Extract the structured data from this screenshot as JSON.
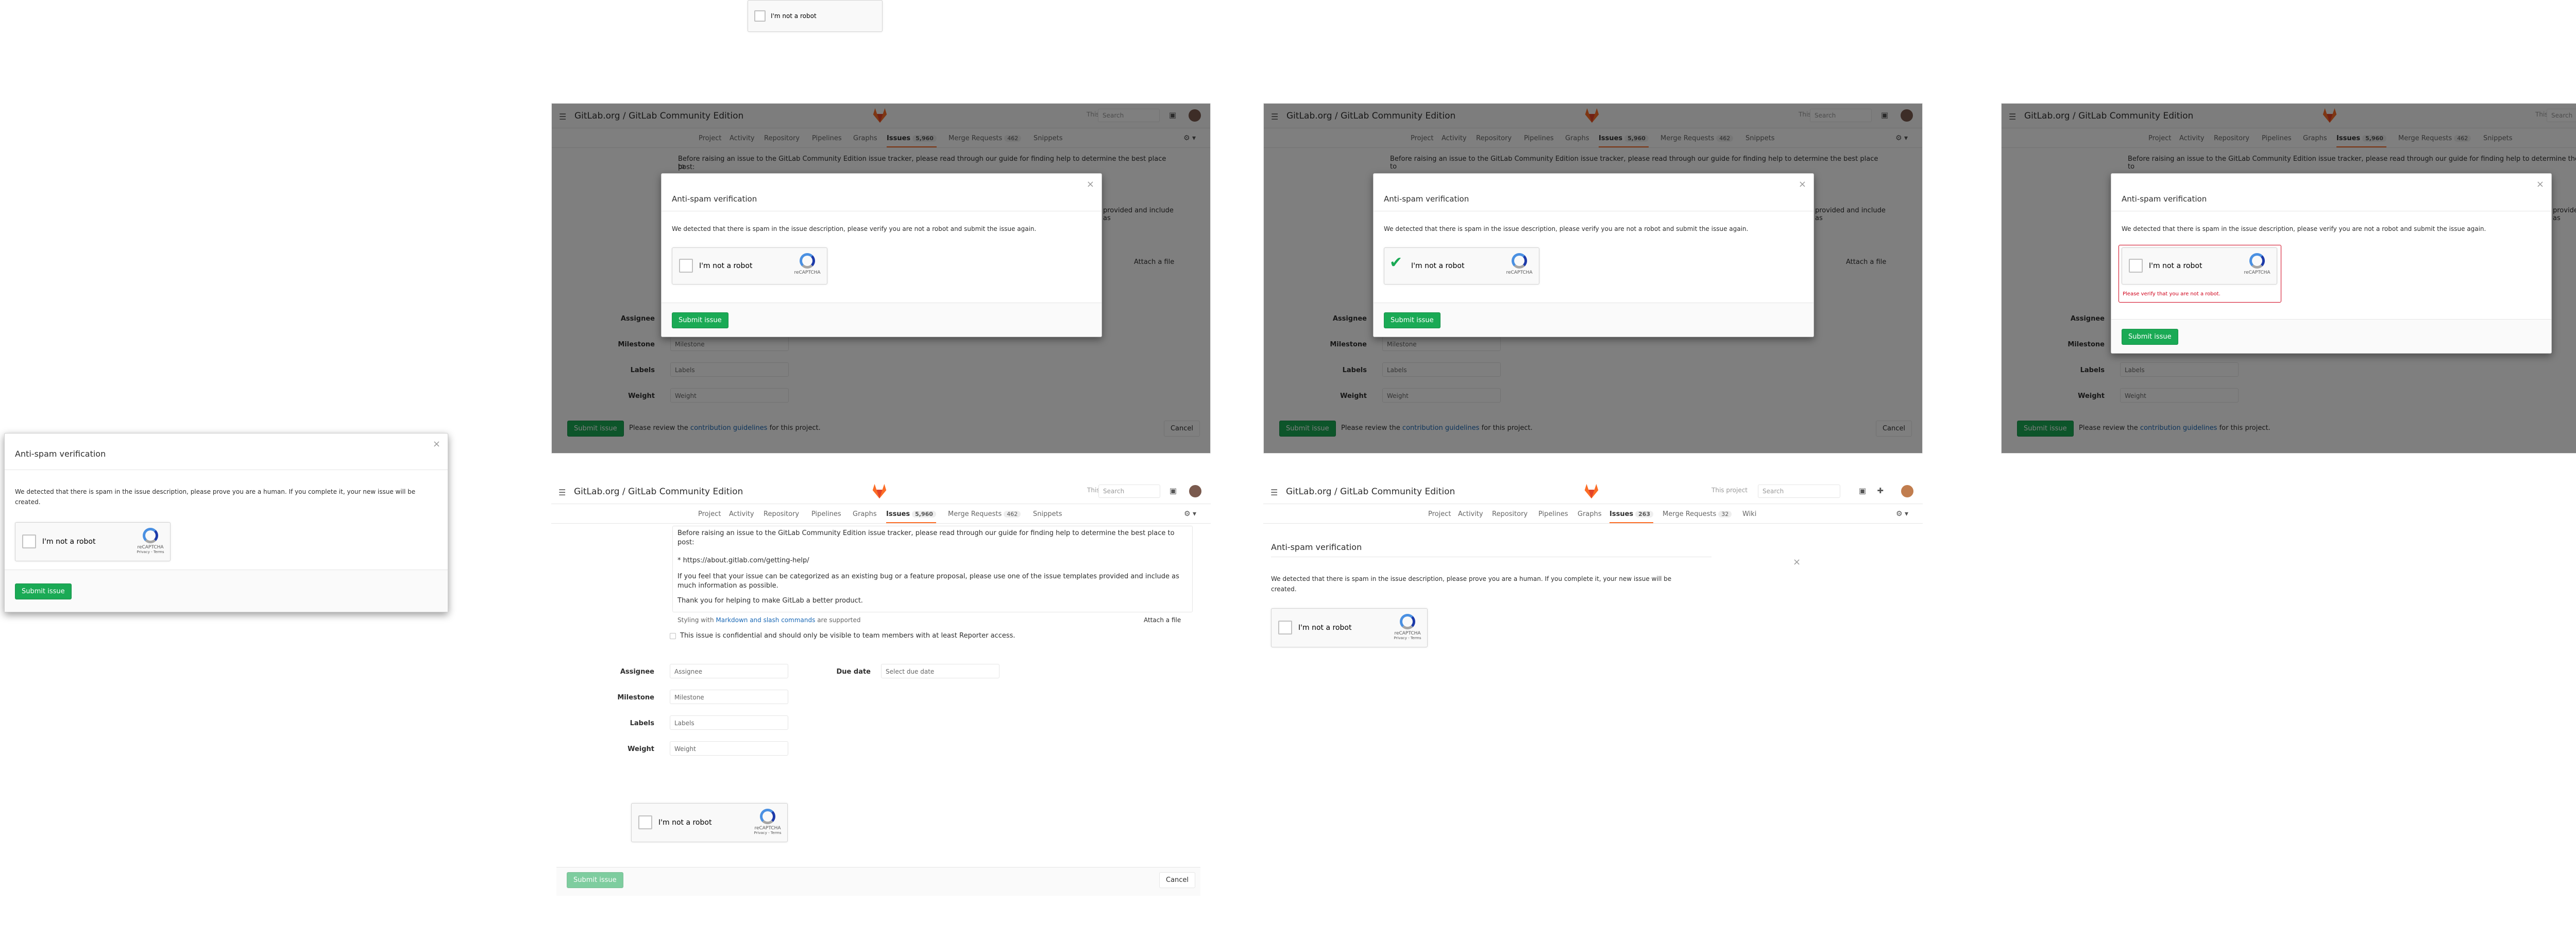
{
  "recaptcha": {
    "label": "I'm not a robot",
    "brand": "reCAPTCHA",
    "privacy": "Privacy - Terms"
  },
  "gitlab": {
    "title": "GitLab.org / GitLab Community Edition",
    "title_simple": "GitLab.org / GitLab Community Edition",
    "scope": "This project",
    "search_placeholder": "Search",
    "tabs": [
      "Project",
      "Activity",
      "Repository",
      "Pipelines",
      "Graphs",
      "Issues",
      "Merge Requests",
      "Snippets"
    ],
    "tabs_simple": [
      "Project",
      "Activity",
      "Repository",
      "Pipelines",
      "Graphs",
      "Issues",
      "Merge Requests",
      "Wiki"
    ],
    "issues_count": "5,960",
    "mr_count": "462",
    "issues_count_simple": "263",
    "mr_count_simple": "32",
    "intro": "Before raising an issue to the GitLab Community Edition issue tracker, please read through our guide for finding help to determine the best place to post:",
    "intro_short": "Before raising an issue to the GitLab Community Edition issue tracker, please read through our guide for finding help to determine the best place to",
    "intro_short2": "post:",
    "help_link": "* https://about.gitlab.com/getting-help/",
    "feel": "If you feel that your issue can be categorized as an existing bug or a feature proposal, please use one of the issue templates provided and include as much information as possible.",
    "feel_frag": "provided and include as",
    "thanks": "Thank you for helping to make GitLab a better product.",
    "styling_pre": "Styling with",
    "styling_link": "Markdown and slash commands",
    "styling_post": "are supported",
    "attach": "Attach a file",
    "confidential": "This issue is confidential and should only be visible to team members with at least Reporter access.",
    "assignee_label": "Assignee",
    "milestone_label": "Milestone",
    "labels_label": "Labels",
    "weight_label": "Weight",
    "due_label": "Due date",
    "assignee_ph": "Assignee",
    "milestone_ph": "Milestone",
    "labels_ph": "Labels",
    "weight_ph": "Weight",
    "due_ph": "Select due date",
    "submit": "Submit issue",
    "cancel": "Cancel",
    "review_pre": "Please review the",
    "review_link": "contribution guidelines",
    "review_post": "for this project."
  },
  "modal": {
    "title": "Anti-spam verification",
    "desc_robot": "We detected that there is spam in the issue description, please verify you are not a robot and submit the issue again.",
    "desc_human": "We detected that there is spam in the issue description, please prove you are a human. If you complete it, your new issue will be created.",
    "error": "Please verify that you are not a robot.",
    "close": "×"
  },
  "colors": {
    "accent_green": "#1aaa55",
    "error_red": "#d0021b",
    "link_blue": "#1b69b6",
    "tanuki_orange": "#fc6d26"
  }
}
